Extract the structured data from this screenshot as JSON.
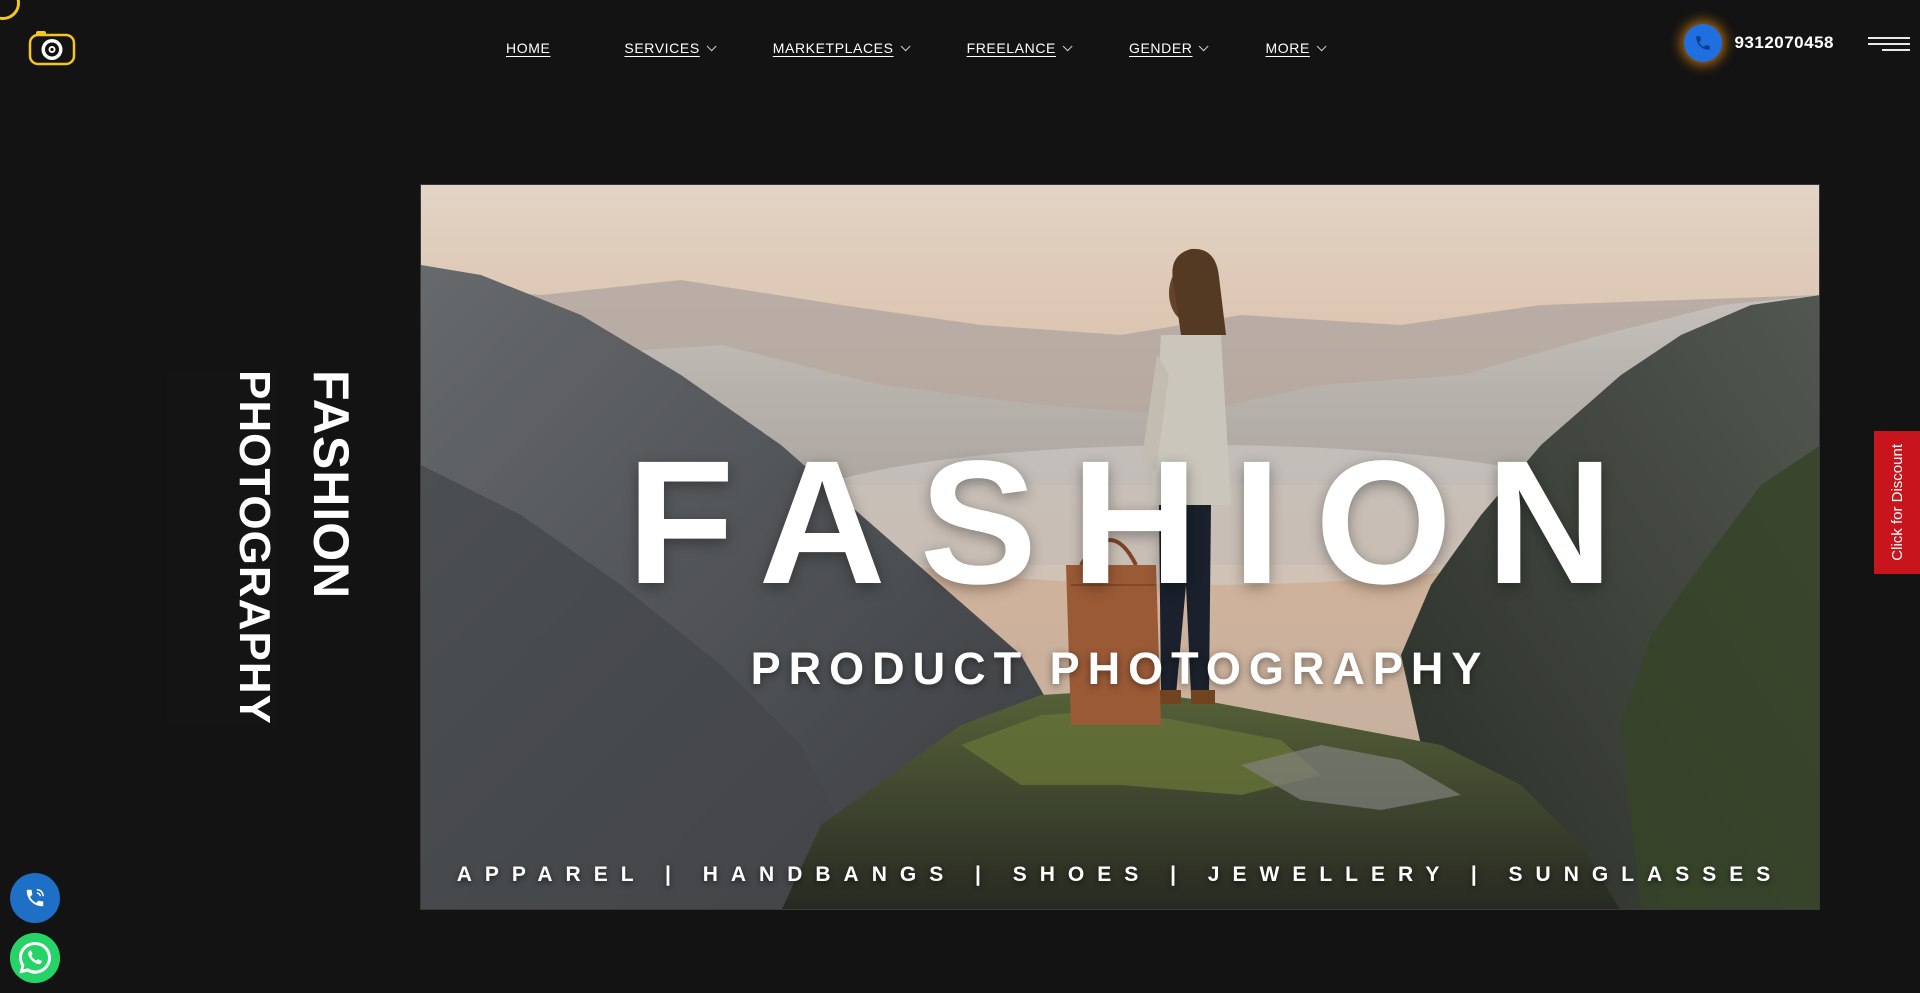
{
  "header": {
    "logo_icon": "camera-logo-icon",
    "nav": [
      {
        "label": "HOME",
        "has_dropdown": false
      },
      {
        "label": "SERVICES",
        "has_dropdown": true
      },
      {
        "label": "MARKETPLACES",
        "has_dropdown": true
      },
      {
        "label": "FREELANCE",
        "has_dropdown": true
      },
      {
        "label": "GENDER",
        "has_dropdown": true
      },
      {
        "label": "MORE",
        "has_dropdown": true
      }
    ],
    "phone_icon": "phone-icon",
    "phone_number": "9312070458",
    "menu_icon": "hamburger-menu-icon"
  },
  "side_text": {
    "line1": "PHOTOGRAPHY",
    "line2": "FASHION"
  },
  "hero": {
    "title": "FASHION",
    "subtitle": "PRODUCT PHOTOGRAPHY",
    "categories": "APPAREL | HANDBANGS | SHOES | JEWELLERY | SUNGLASSES"
  },
  "discount_tab": {
    "label": "Click for Discount"
  },
  "floating": {
    "call_icon": "phone-call-icon",
    "whatsapp_icon": "whatsapp-icon"
  },
  "colors": {
    "background": "#131313",
    "accent_yellow": "#f3c623",
    "phone_blue": "#1f6fe0",
    "discount_red": "#c8141c",
    "whatsapp_green": "#25d366"
  }
}
